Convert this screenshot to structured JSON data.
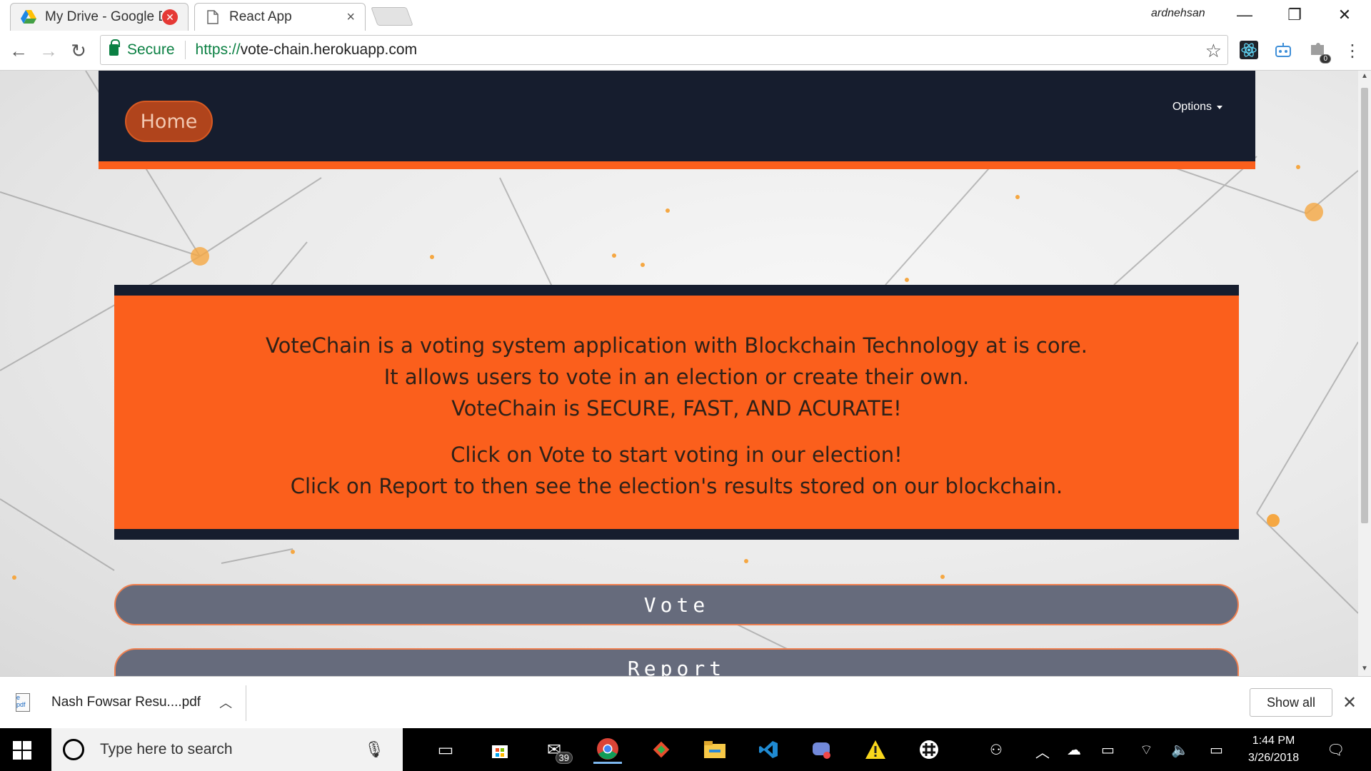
{
  "browser": {
    "tabs": [
      {
        "title": "My Drive - Google D",
        "icon": "google-drive-icon",
        "close": "x-circle"
      },
      {
        "title": "React App",
        "icon": "page-icon",
        "close": "×"
      }
    ],
    "profile_name": "ardnehsan",
    "security_label": "Secure",
    "url_scheme": "https://",
    "url_host": "vote-chain.herokuapp.com",
    "extensions": [
      "react-devtools-icon",
      "robot-extension-icon",
      "puzzle-extension-icon"
    ],
    "extension_badge": "0"
  },
  "navbar": {
    "home_label": "Home",
    "options_label": "Options"
  },
  "info": {
    "line1": "VoteChain is a voting system application with Blockchain Technology at is core.",
    "line2": "It allows users to vote in an election or create their own.",
    "line3": "VoteChain is SECURE, FAST, AND ACURATE!",
    "line4": "Click on Vote to start voting in our election!",
    "line5": "Click on Report to then see the election's results stored on our blockchain."
  },
  "actions": {
    "vote_label": "Vote",
    "report_label": "Report"
  },
  "downloads": {
    "file_name": "Nash Fowsar Resu....pdf",
    "file_icon_text": "e pdf",
    "show_all_label": "Show all"
  },
  "taskbar": {
    "search_placeholder": "Type here to search",
    "mail_badge": "39",
    "time": "1:44 PM",
    "date": "3/26/2018"
  },
  "colors": {
    "navbar_bg": "#161d2e",
    "accent_orange": "#fb5f1c",
    "home_button": "#b0441c",
    "pill_bg": "#666b7c"
  }
}
